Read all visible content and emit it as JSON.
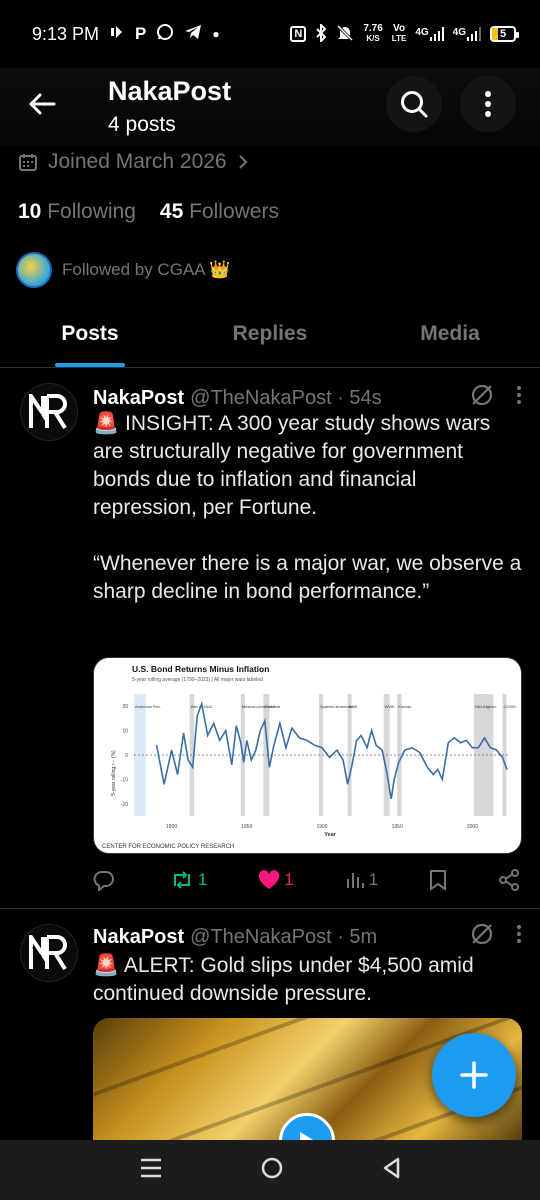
{
  "status_bar": {
    "time": "9:13 PM",
    "left_icons": [
      "audio-notification-icon",
      "p-app-icon",
      "whatsapp-icon",
      "telegram-icon",
      "dot-icon"
    ],
    "net_speed_top": "7.76",
    "net_speed_bottom": "K/S",
    "volte_top": "Vo",
    "volte_bottom": "LTE",
    "signal_1": "4G",
    "signal_2": "4G",
    "battery": "5"
  },
  "header": {
    "title": "NakaPost",
    "subtitle": "4 posts"
  },
  "profile": {
    "joined": "Joined March 2026",
    "following_count": "10",
    "following_label": "Following",
    "followers_count": "45",
    "followers_label": "Followers",
    "followed_by": "Followed by CGAA 👑"
  },
  "tabs": [
    {
      "label": "Posts",
      "active": true
    },
    {
      "label": "Replies",
      "active": false
    },
    {
      "label": "Media",
      "active": false
    }
  ],
  "posts": [
    {
      "name": "NakaPost",
      "handle": "@TheNakaPost · 54s",
      "text": "🚨 INSIGHT: A 300 year study shows wars are structurally negative for government bonds due to inflation and financial repression, per Fortune.\n\n“Whenever there is a major war, we observe a sharp decline in bond performance.”",
      "replies": "",
      "reposts": "1",
      "likes": "1",
      "views": "1"
    },
    {
      "name": "NakaPost",
      "handle": "@TheNakaPost · 5m",
      "text": "🚨 ALERT: Gold slips under $4,500 amid continued downside pressure."
    }
  ],
  "chart_card": {
    "title": "U.S. Bond Returns Minus Inflation",
    "subtitle": "5-year rolling average (1790–2023) | All major wars labeled",
    "ylabel": "5-year rolling r − (%)",
    "xlabel": "Year",
    "source": "CENTER FOR ECONOMIC POLICY RESEARCH",
    "war_labels": [
      "American Rev.",
      "War of 1812",
      "Mexican-American",
      "Civil War",
      "Spanish-American",
      "WWI",
      "WWII",
      "Korean",
      "Viet-Afghan.",
      "COVID"
    ]
  },
  "chart_data": {
    "type": "line",
    "title": "U.S. Bond Returns Minus Inflation",
    "subtitle": "5-year rolling average (1790–2023) | All major wars labeled",
    "xlabel": "Year",
    "ylabel": "5-year rolling r − (%)",
    "xlim": [
      1775,
      2025
    ],
    "ylim": [
      -25,
      25
    ],
    "x_ticks": [
      "1800",
      "1850",
      "1900",
      "1950",
      "2000"
    ],
    "y_ticks": [
      "20",
      "10",
      "0",
      "-10",
      "-20"
    ],
    "series": [
      {
        "x": [
          1790,
          1795,
          1800,
          1804,
          1808,
          1811,
          1814,
          1817,
          1820,
          1824,
          1828,
          1832,
          1836,
          1840,
          1843,
          1846,
          1848,
          1850,
          1853,
          1856,
          1859,
          1862,
          1865,
          1868,
          1872,
          1876,
          1880,
          1885,
          1890,
          1895,
          1900,
          1905,
          1910,
          1914,
          1917,
          1920,
          1923,
          1926,
          1930,
          1933,
          1936,
          1940,
          1943,
          1946,
          1948,
          1951,
          1955,
          1960,
          1965,
          1970,
          1974,
          1977,
          1980,
          1984,
          1988,
          1992,
          1996,
          2000,
          2004,
          2008,
          2012,
          2016,
          2020,
          2023
        ],
        "y": [
          4,
          -12,
          2,
          -8,
          9,
          -2,
          -5,
          16,
          21,
          8,
          13,
          6,
          10,
          -4,
          12,
          5,
          -3,
          6,
          -2,
          2,
          10,
          14,
          -5,
          4,
          13,
          3,
          11,
          7,
          6,
          4,
          3,
          -1,
          2,
          -2,
          -12,
          -4,
          6,
          8,
          3,
          10,
          4,
          2,
          -7,
          -18,
          -10,
          -3,
          2,
          3,
          1,
          -5,
          -8,
          -6,
          -10,
          5,
          7,
          5,
          6,
          3,
          3,
          7,
          3,
          2,
          -1,
          -6
        ]
      }
    ],
    "shaded_war_periods": [
      [
        1775,
        1783
      ],
      [
        1812,
        1815
      ],
      [
        1846,
        1848
      ],
      [
        1861,
        1865
      ],
      [
        1898,
        1899
      ],
      [
        1917,
        1918
      ],
      [
        1941,
        1945
      ],
      [
        1950,
        1953
      ],
      [
        2001,
        2014
      ],
      [
        2020,
        2021
      ]
    ]
  },
  "colors": {
    "accent": "#1d9bf0",
    "muted": "#71767b",
    "repost": "#00ba7c",
    "like": "#f91880",
    "line": "#3b6ea8"
  }
}
